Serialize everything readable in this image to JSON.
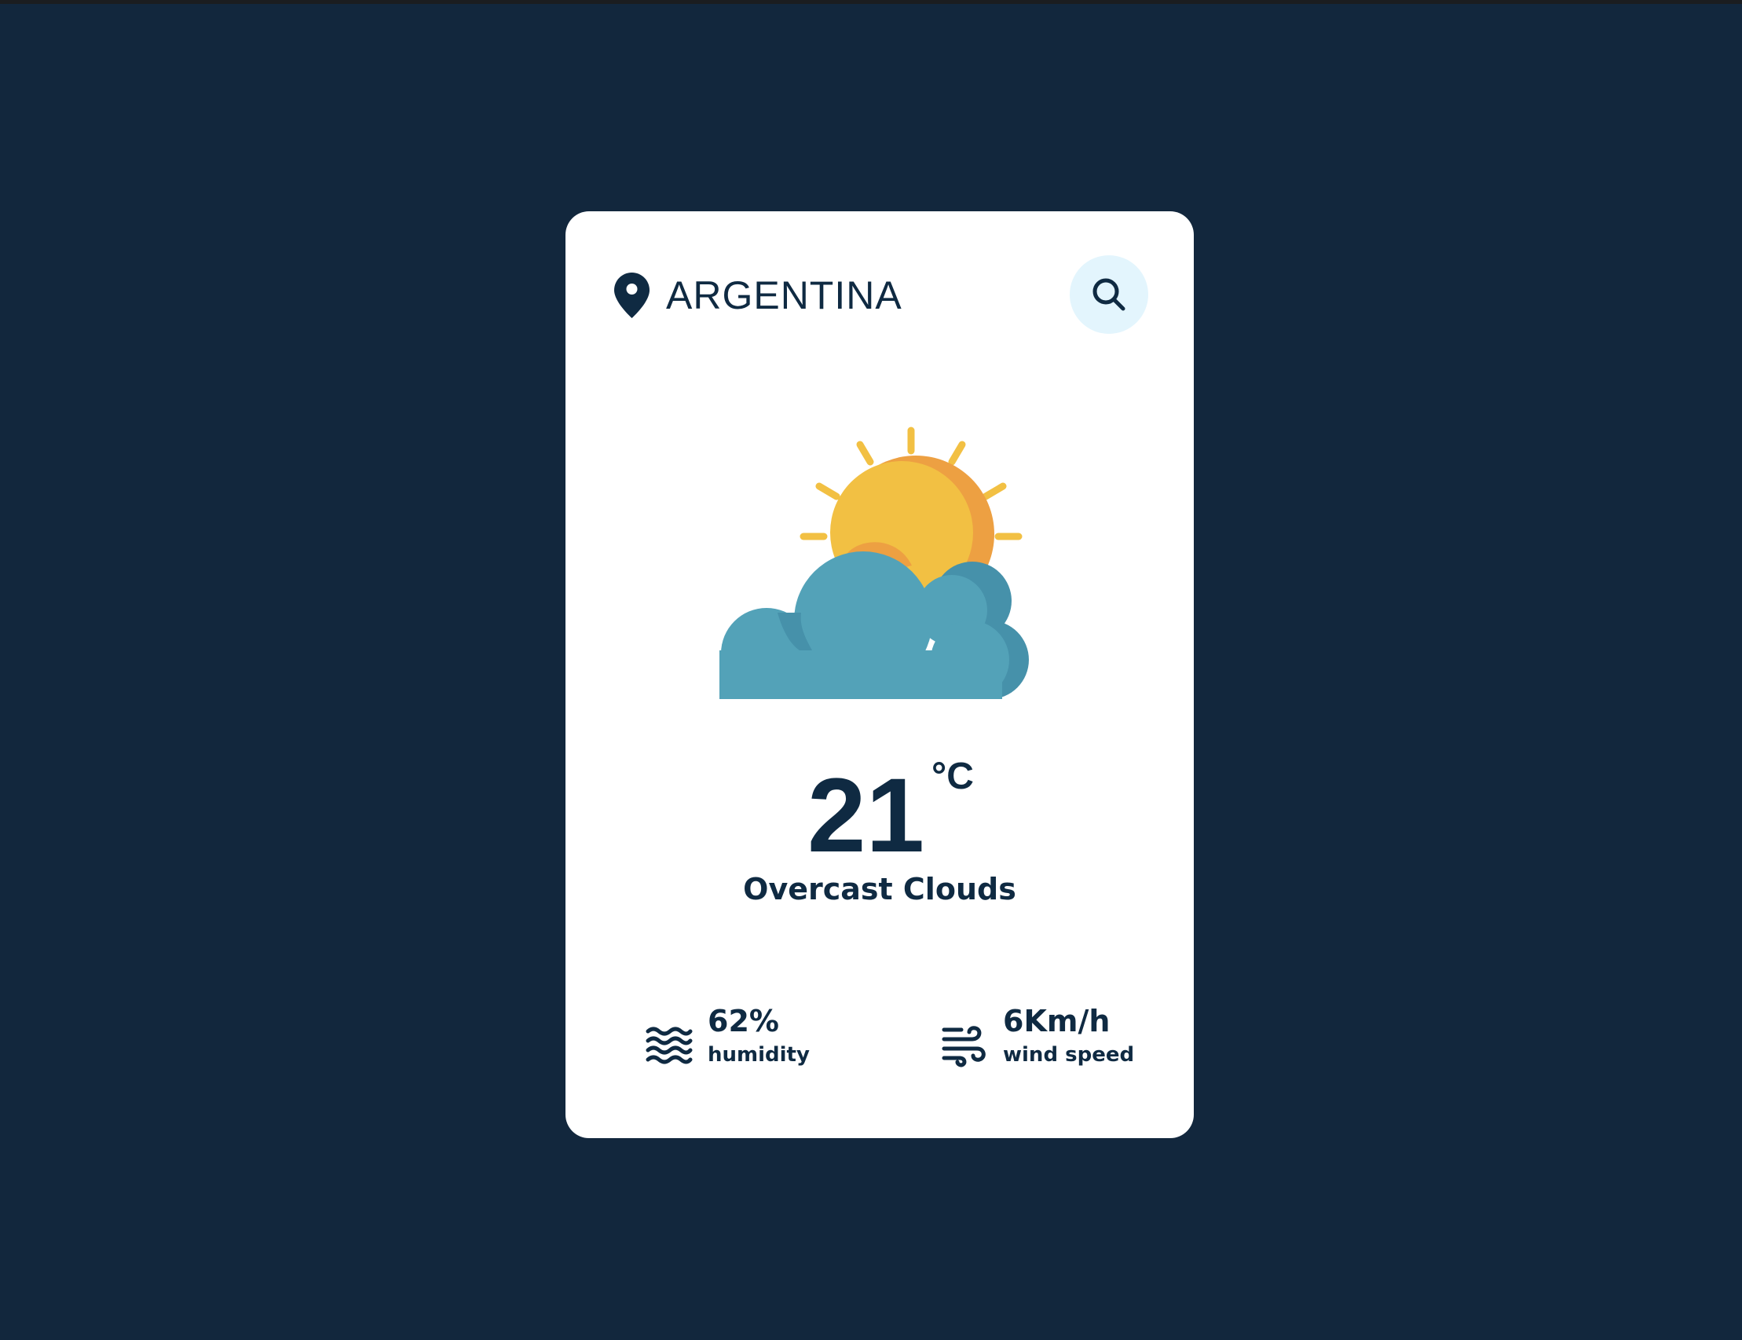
{
  "location": {
    "name": "ARGENTINA",
    "icon": "location-pin-icon"
  },
  "search": {
    "icon": "search-icon"
  },
  "weather": {
    "icon": "partly-cloudy-icon",
    "temperature": "21",
    "unit": "°C",
    "condition": "Overcast Clouds"
  },
  "stats": {
    "humidity": {
      "value": "62%",
      "label": "humidity",
      "icon": "humidity-waves-icon"
    },
    "wind": {
      "value": "6Km/h",
      "label": "wind speed",
      "icon": "wind-icon"
    }
  },
  "colors": {
    "background": "#12273d",
    "card": "#ffffff",
    "text": "#0f2a42",
    "search_button_bg": "#e3f5fd",
    "sun": "#f2c043",
    "sun_shade": "#eda042",
    "cloud": "#53a2b8",
    "cloud_shade": "#4691aa"
  }
}
